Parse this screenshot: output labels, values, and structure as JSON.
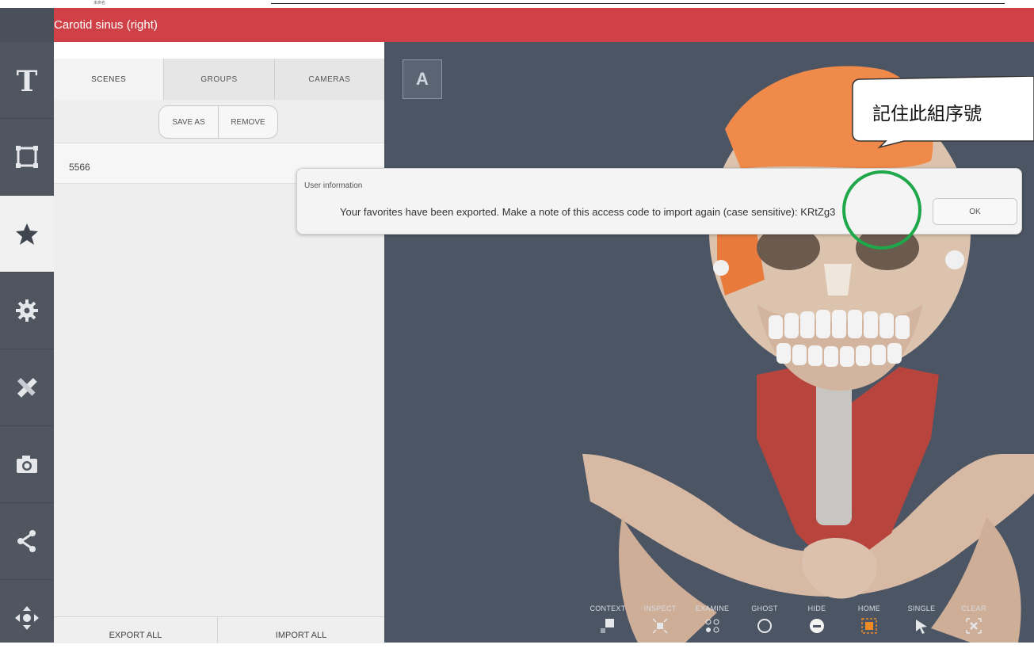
{
  "header": {
    "title": "Carotid sinus (right)"
  },
  "top_strip_text": "未命名",
  "sidebar": {
    "items": [
      {
        "name": "text"
      },
      {
        "name": "frame"
      },
      {
        "name": "favorites",
        "active": true
      },
      {
        "name": "settings"
      },
      {
        "name": "tools"
      },
      {
        "name": "camera"
      },
      {
        "name": "share"
      },
      {
        "name": "move"
      }
    ]
  },
  "panel": {
    "tabs": [
      "SCENES",
      "GROUPS",
      "CAMERAS"
    ],
    "save_as": "SAVE AS",
    "remove": "REMOVE",
    "scene_name": "5566",
    "export_all": "EXPORT ALL",
    "import_all": "IMPORT ALL"
  },
  "viewer": {
    "a_label": "A"
  },
  "toolbar": [
    "CONTEXT",
    "INSPECT",
    "EXAMINE",
    "GHOST",
    "HIDE",
    "HOME",
    "SINGLE",
    "CLEAR"
  ],
  "dialog": {
    "title": "User information",
    "message": "Your favorites have been exported. Make a note of this access code to import again (case sensitive): KRtZg3",
    "ok": "OK"
  },
  "callout": {
    "text": "記住此組序號"
  },
  "colors": {
    "header": "#cf4146",
    "sidebar": "#50565f",
    "viewer": "#4b5563",
    "highlight": "#1ea84a",
    "home_orange": "#f08a24"
  }
}
